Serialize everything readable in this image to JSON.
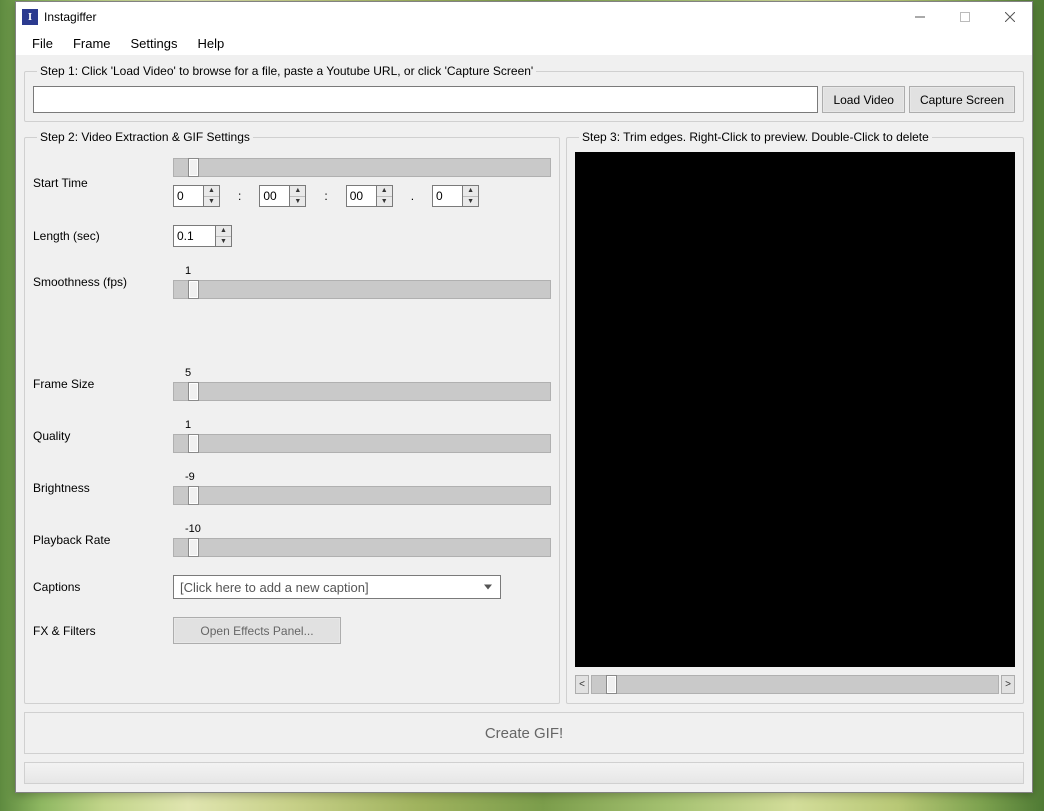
{
  "app": {
    "title": "Instagiffer",
    "icon_letter": "I"
  },
  "menu": {
    "file": "File",
    "frame": "Frame",
    "settings": "Settings",
    "help": "Help"
  },
  "step1": {
    "legend": "Step 1: Click 'Load Video' to browse for a file, paste a Youtube URL, or click 'Capture Screen'",
    "url_value": "",
    "load_video": "Load Video",
    "capture_screen": "Capture Screen"
  },
  "step2": {
    "legend": "Step 2: Video Extraction & GIF Settings",
    "labels": {
      "start_time": "Start Time",
      "length": "Length (sec)",
      "smoothness": "Smoothness (fps)",
      "frame_size": "Frame Size",
      "quality": "Quality",
      "brightness": "Brightness",
      "playback_rate": "Playback Rate",
      "captions": "Captions",
      "fx": "FX & Filters"
    },
    "time": {
      "h": "0",
      "m": "00",
      "s": "00",
      "cs": "0",
      "sep_colon": ":",
      "sep_dot": "."
    },
    "length_value": "0.1",
    "slider_values": {
      "smoothness": "1",
      "frame_size": "5",
      "quality": "1",
      "brightness": "-9",
      "playback_rate": "-10"
    },
    "captions_placeholder": "[Click here to add a new caption]",
    "fx_button": "Open Effects Panel..."
  },
  "step3": {
    "legend": "Step 3: Trim edges. Right-Click to preview. Double-Click to delete",
    "prev": "<",
    "next": ">"
  },
  "create_gif": "Create GIF!",
  "window_controls": {
    "min": "Minimize",
    "max": "Maximize",
    "close": "Close"
  }
}
